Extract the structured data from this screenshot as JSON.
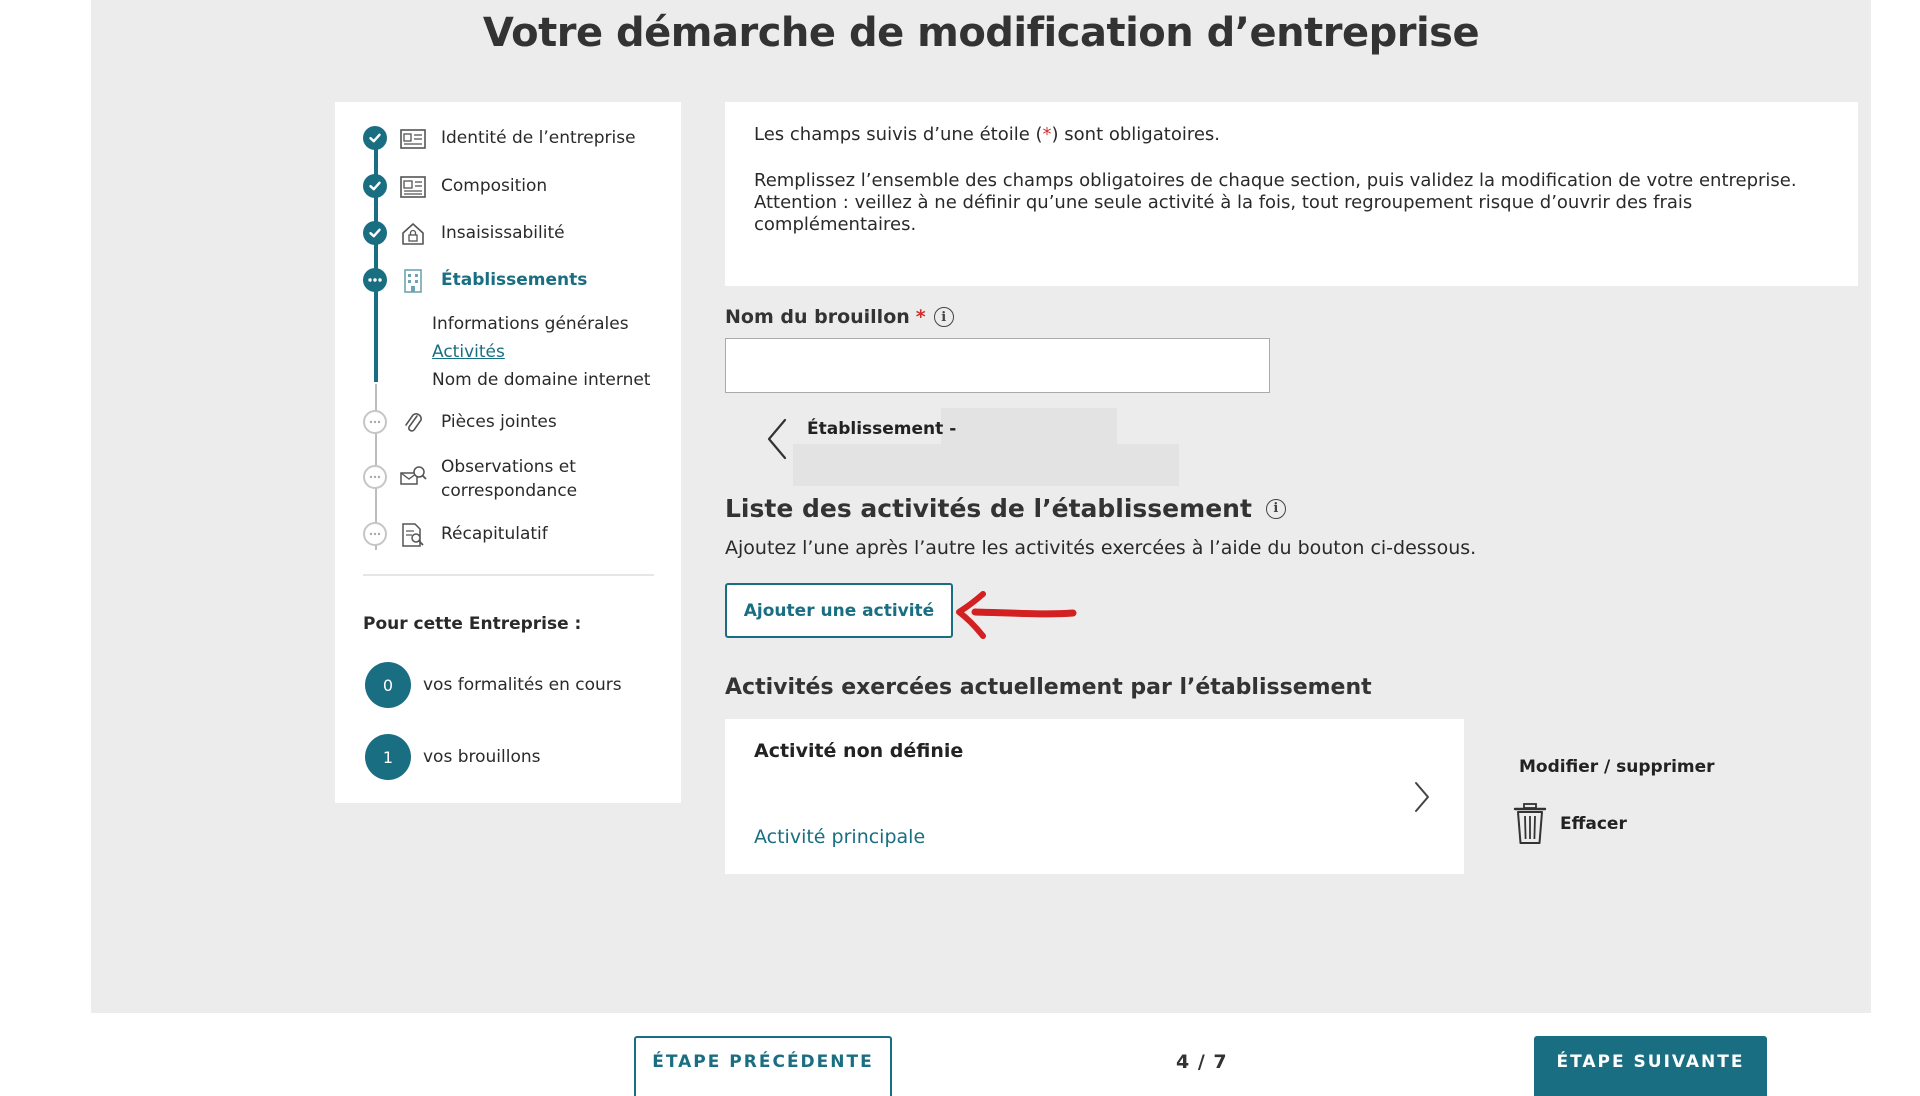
{
  "page": {
    "title": "Votre démarche de modification d’entreprise"
  },
  "stepper": {
    "steps": [
      {
        "label": "Identité de l’entreprise",
        "status": "done",
        "icon": "id-card-icon"
      },
      {
        "label": "Composition",
        "status": "done",
        "icon": "newspaper-icon"
      },
      {
        "label": "Insaisissabilité",
        "status": "done",
        "icon": "house-lock-icon"
      },
      {
        "label": "Établissements",
        "status": "current",
        "icon": "building-icon"
      },
      {
        "label": "Pièces jointes",
        "status": "todo",
        "icon": "paperclip-icon"
      },
      {
        "label": "Observations et correspondance",
        "label_line1": "Observations et",
        "label_line2": "correspondance",
        "status": "todo",
        "icon": "envelope-search-icon"
      },
      {
        "label": "Récapitulatif",
        "status": "todo",
        "icon": "document-search-icon"
      }
    ],
    "substeps": [
      {
        "label": "Informations générales",
        "active": false
      },
      {
        "label": "Activités",
        "active": true
      },
      {
        "label": "Nom de domaine internet",
        "active": false
      }
    ],
    "for_company_title": "Pour cette Entreprise :",
    "counters": [
      {
        "value": "0",
        "label": "vos formalités en cours"
      },
      {
        "value": "1",
        "label": "vos brouillons"
      }
    ]
  },
  "info": {
    "required_prefix": "Les champs suivis d’une étoile (",
    "required_star": "*",
    "required_suffix": ") sont obligatoires.",
    "paragraph2": "Remplissez l’ensemble des champs obligatoires de chaque section, puis validez la modification de votre entreprise.",
    "paragraph3": "Attention : veillez à ne définir qu’une seule activité à la fois, tout regroupement risque d’ouvrir des frais complémentaires."
  },
  "draft": {
    "label": "Nom du brouillon",
    "required_star": "*",
    "info_glyph": "i",
    "value": ""
  },
  "establishment": {
    "label": "Établissement -"
  },
  "activities": {
    "title": "Liste des activités de l’établissement",
    "info_glyph": "i",
    "description": "Ajoutez l’une après l’autre les activités exercées à l’aide du bouton ci-dessous.",
    "add_button": "Ajouter une activité",
    "current_title": "Activités exercées actuellement par l’établissement",
    "card": {
      "title": "Activité non définie",
      "type": "Activité principale"
    },
    "modify_label": "Modifier / supprimer",
    "erase_label": "Effacer"
  },
  "navigation": {
    "prev": "ÉTAPE PRÉCÉDENTE",
    "page_indicator": "4 / 7",
    "next": "ÉTAPE SUIVANTE"
  },
  "colors": {
    "accent": "#1a6e82",
    "required": "#d32f2f",
    "annotation_arrow": "#d32020",
    "background": "#ececec"
  }
}
